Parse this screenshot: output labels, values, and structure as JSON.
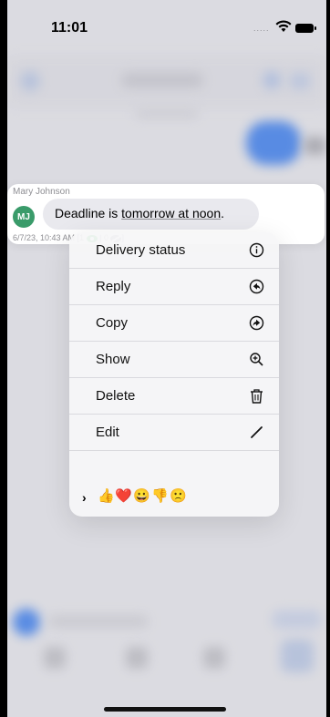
{
  "status_bar": {
    "time": "11:01",
    "signal": "....."
  },
  "message": {
    "sender": "Mary Johnson",
    "avatar_initials": "MJ",
    "avatar_color": "#3a9b6a",
    "text_before": "Deadline is ",
    "text_link": "tomorrow at noon",
    "text_after": ".",
    "timestamp": "6/7/23, 10:43 AM",
    "seen_prefix": "[1",
    "seen_sep": "| 0",
    "seen_suffix": "]"
  },
  "menu": {
    "items": [
      {
        "label": "Delivery status",
        "icon": "info-icon"
      },
      {
        "label": "Reply",
        "icon": "reply-icon"
      },
      {
        "label": "Copy",
        "icon": "forward-icon"
      },
      {
        "label": "Show",
        "icon": "zoom-in-icon"
      },
      {
        "label": "Delete",
        "icon": "trash-icon"
      },
      {
        "label": "Edit",
        "icon": "pencil-icon"
      }
    ],
    "reactions": [
      "👍",
      "❤️",
      "😀",
      "👎",
      "🙁"
    ]
  },
  "colors": {
    "accent": "#3a7ef0",
    "seen_eye": "#2fb34a"
  }
}
